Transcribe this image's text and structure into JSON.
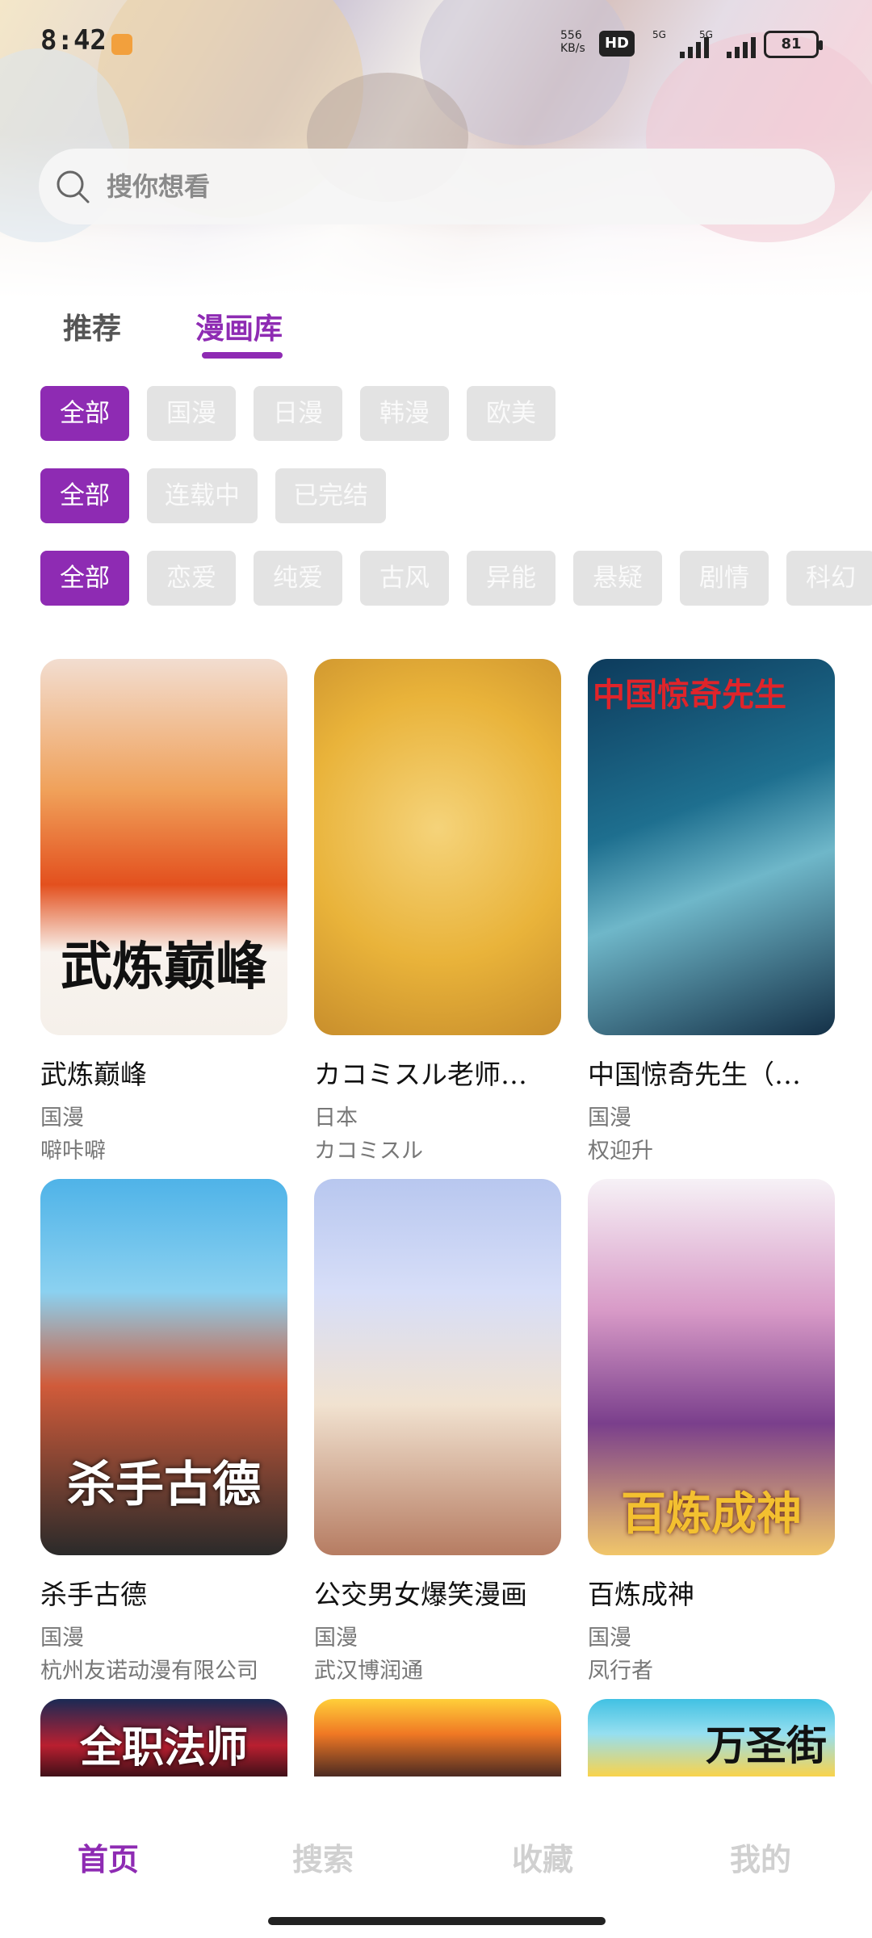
{
  "status_bar": {
    "time": "8:42",
    "speed_top": "556",
    "speed_bottom": "KB/s",
    "hd": "HD",
    "signal1_label": "5G",
    "signal2_label": "5G",
    "battery": "81"
  },
  "search": {
    "placeholder": "搜你想看"
  },
  "tabs": [
    {
      "label": "推荐",
      "active": false
    },
    {
      "label": "漫画库",
      "active": true
    }
  ],
  "filters": {
    "region": [
      "全部",
      "国漫",
      "日漫",
      "韩漫",
      "欧美"
    ],
    "status": [
      "全部",
      "连载中",
      "已完结"
    ],
    "genre": [
      "全部",
      "恋爱",
      "纯爱",
      "古风",
      "异能",
      "悬疑",
      "剧情",
      "科幻"
    ]
  },
  "comics": [
    {
      "title": "武炼巅峰",
      "region": "国漫",
      "author": "噼咔噼",
      "cover_text": "武炼巅峰"
    },
    {
      "title": "カコミスル老师…",
      "region": "日本",
      "author": "カコミスル",
      "cover_text": ""
    },
    {
      "title": "中国惊奇先生（…",
      "region": "国漫",
      "author": "权迎升",
      "cover_text": "中国惊奇先生"
    },
    {
      "title": "杀手古德",
      "region": "国漫",
      "author": "杭州友诺动漫有限公司",
      "cover_text": "杀手古德"
    },
    {
      "title": "公交男女爆笑漫画",
      "region": "国漫",
      "author": "武汉博润通",
      "cover_text": ""
    },
    {
      "title": "百炼成神",
      "region": "国漫",
      "author": "凤行者",
      "cover_text": "百炼成神"
    },
    {
      "title": "",
      "region": "",
      "author": "",
      "cover_text": "全职法师"
    },
    {
      "title": "",
      "region": "",
      "author": "",
      "cover_text": ""
    },
    {
      "title": "",
      "region": "",
      "author": "",
      "cover_text": "万圣街"
    }
  ],
  "bottom_nav": [
    {
      "label": "首页",
      "active": true
    },
    {
      "label": "搜索",
      "active": false
    },
    {
      "label": "收藏",
      "active": false
    },
    {
      "label": "我的",
      "active": false
    }
  ],
  "colors": {
    "accent": "#8e2bb3",
    "chip_inactive": "#e3e3e3",
    "nav_inactive": "#d0d0d0"
  }
}
